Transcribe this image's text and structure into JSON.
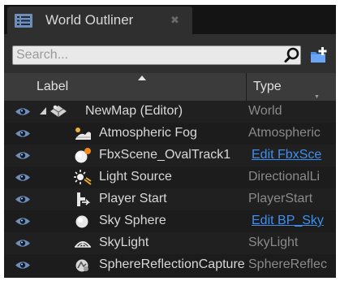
{
  "tab": {
    "title": "World Outliner",
    "icon": "list-icon",
    "close_icon": "close-icon"
  },
  "search": {
    "placeholder": "Search...",
    "icon": "search-icon"
  },
  "toolbar": {
    "add_folder_icon": "add-folder-icon"
  },
  "columns": {
    "label": "Label",
    "type": "Type"
  },
  "colors": {
    "panel": "#1c1c1c",
    "link": "#3f8ff0",
    "eye": "#6f8fb8"
  },
  "rows": [
    {
      "label": "NewMap (Editor)",
      "type": "World",
      "type_is_link": false,
      "icon": "world-icon",
      "expanded": true
    },
    {
      "label": "Atmospheric Fog",
      "type": "Atmospheric",
      "type_is_link": false,
      "icon": "fog-icon"
    },
    {
      "label": "FbxScene_OvalTrack1",
      "type": "Edit FbxSce",
      "type_is_link": true,
      "icon": "blueprint-sphere-icon"
    },
    {
      "label": "Light Source",
      "type": "DirectionalLi",
      "type_is_link": false,
      "icon": "sun-icon"
    },
    {
      "label": "Player Start",
      "type": "PlayerStart",
      "type_is_link": false,
      "icon": "player-start-icon"
    },
    {
      "label": "Sky Sphere",
      "type": "Edit BP_Sky",
      "type_is_link": true,
      "icon": "sphere-icon"
    },
    {
      "label": "SkyLight",
      "type": "SkyLight",
      "type_is_link": false,
      "icon": "skylight-icon"
    },
    {
      "label": "SphereReflectionCapture",
      "type": "SphereReflec",
      "type_is_link": false,
      "icon": "reflection-capture-icon"
    }
  ]
}
